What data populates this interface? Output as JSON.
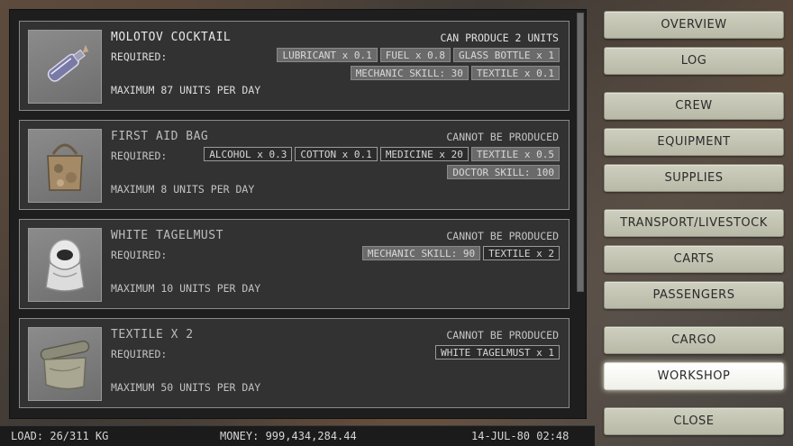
{
  "recipes": [
    {
      "name": "MOLOTOV COCKTAIL",
      "status": "CAN PRODUCE 2 UNITS",
      "required_label": "REQUIRED:",
      "requirements": [
        {
          "label": "LUBRICANT x 0.1",
          "style": "filled"
        },
        {
          "label": "FUEL x 0.8",
          "style": "filled"
        },
        {
          "label": "GLASS BOTTLE x 1",
          "style": "filled"
        },
        {
          "label": "MECHANIC SKILL: 30",
          "style": "filled"
        },
        {
          "label": "TEXTILE x 0.1",
          "style": "filled"
        }
      ],
      "max": "MAXIMUM 87 UNITS PER DAY",
      "icon": "molotov-bottle-icon",
      "producible": true
    },
    {
      "name": "FIRST AID BAG",
      "status": "CANNOT BE PRODUCED",
      "required_label": "REQUIRED:",
      "requirements": [
        {
          "label": "ALCOHOL x 0.3",
          "style": "outline"
        },
        {
          "label": "COTTON x 0.1",
          "style": "outline"
        },
        {
          "label": "MEDICINE x 20",
          "style": "outline"
        },
        {
          "label": "TEXTILE x 0.5",
          "style": "filled"
        },
        {
          "label": "DOCTOR SKILL: 100",
          "style": "filled"
        }
      ],
      "max": "MAXIMUM 8 UNITS PER DAY",
      "icon": "first-aid-bag-icon",
      "producible": false
    },
    {
      "name": "WHITE TAGELMUST",
      "status": "CANNOT BE PRODUCED",
      "required_label": "REQUIRED:",
      "requirements": [
        {
          "label": "MECHANIC SKILL: 90",
          "style": "filled"
        },
        {
          "label": "TEXTILE x 2",
          "style": "outline"
        }
      ],
      "max": "MAXIMUM 10 UNITS PER DAY",
      "icon": "tagelmust-scarf-icon",
      "producible": false
    },
    {
      "name": "TEXTILE X 2",
      "status": "CANNOT BE PRODUCED",
      "required_label": "REQUIRED:",
      "requirements": [
        {
          "label": "WHITE TAGELMUST x 1",
          "style": "outline"
        }
      ],
      "max": "MAXIMUM 50 UNITS PER DAY",
      "icon": "textile-cloth-icon",
      "producible": false
    }
  ],
  "statusbar": {
    "load": "LOAD: 26/311 KG",
    "money": "MONEY: 999,434,284.44",
    "datetime": "14-JUL-80 02:48"
  },
  "nav": [
    {
      "label": "OVERVIEW",
      "active": false
    },
    {
      "label": "LOG",
      "active": false
    },
    {
      "label": "CREW",
      "active": false
    },
    {
      "label": "EQUIPMENT",
      "active": false
    },
    {
      "label": "SUPPLIES",
      "active": false
    },
    {
      "label": "TRANSPORT/LIVESTOCK",
      "active": false
    },
    {
      "label": "CARTS",
      "active": false
    },
    {
      "label": "PASSENGERS",
      "active": false
    },
    {
      "label": "CARGO",
      "active": false
    },
    {
      "label": "WORKSHOP",
      "active": true
    },
    {
      "label": "CLOSE",
      "active": false
    }
  ]
}
